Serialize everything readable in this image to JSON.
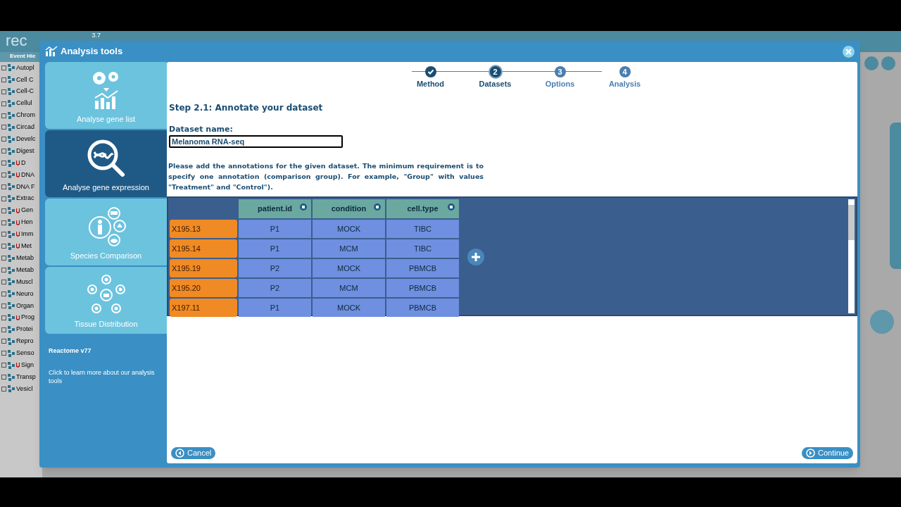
{
  "background_app": {
    "logo": "rec",
    "version_badge": "3.7",
    "tree_header": "Event Hie",
    "tree_items": [
      {
        "label": "Autopl",
        "flag": false
      },
      {
        "label": "Cell C",
        "flag": false
      },
      {
        "label": "Cell-C",
        "flag": false
      },
      {
        "label": "Cellul",
        "flag": false
      },
      {
        "label": "Chrom",
        "flag": false
      },
      {
        "label": "Circad",
        "flag": false
      },
      {
        "label": "Develc",
        "flag": false
      },
      {
        "label": "Digest",
        "flag": false
      },
      {
        "label": "D",
        "flag": true
      },
      {
        "label": "DNA",
        "flag": true
      },
      {
        "label": "DNA F",
        "flag": false
      },
      {
        "label": "Extrac",
        "flag": false
      },
      {
        "label": "Gen",
        "flag": true
      },
      {
        "label": "Hen",
        "flag": true
      },
      {
        "label": "Imm",
        "flag": true
      },
      {
        "label": "Met",
        "flag": true
      },
      {
        "label": "Metab",
        "flag": false
      },
      {
        "label": "Metab",
        "flag": false
      },
      {
        "label": "Muscl",
        "flag": false
      },
      {
        "label": "Neuro",
        "flag": false
      },
      {
        "label": "Organ",
        "flag": false
      },
      {
        "label": "Prog",
        "flag": true
      },
      {
        "label": "Protei",
        "flag": false
      },
      {
        "label": "Repro",
        "flag": false
      },
      {
        "label": "Senso",
        "flag": false
      },
      {
        "label": "Sign",
        "flag": true
      },
      {
        "label": "Transp",
        "flag": false
      },
      {
        "label": "Vesicl",
        "flag": false
      }
    ]
  },
  "dialog": {
    "title": "Analysis tools",
    "sidebar": {
      "items": [
        {
          "label": "Analyse gene list",
          "kind": "genelist",
          "selected": false
        },
        {
          "label": "Analyse gene expression",
          "kind": "expression",
          "selected": true
        },
        {
          "label": "Species Comparison",
          "kind": "species",
          "selected": false
        },
        {
          "label": "Tissue Distribution",
          "kind": "tissue",
          "selected": false
        }
      ],
      "version": "Reactome v77",
      "info": "Click to learn more about our analysis tools"
    },
    "steps": [
      {
        "label": "Method",
        "completed": true,
        "selected": false
      },
      {
        "number": "2",
        "label": "Datasets",
        "completed": false,
        "selected": true
      },
      {
        "number": "3",
        "label": "Options",
        "completed": false,
        "selected": false
      },
      {
        "number": "4",
        "label": "Analysis",
        "completed": false,
        "selected": false
      }
    ],
    "heading": "Step 2.1: Annotate your dataset",
    "dataset_name": {
      "label": "Dataset name:",
      "value": "Melanoma RNA-seq"
    },
    "description": "Please add the annotations for the given dataset. The minimum requirement is to specify one annotation (comparison group). For example, \"Group\" with values \"Treatment\" and \"Control\").",
    "table": {
      "columns": [
        "patient.id",
        "condition",
        "cell.type"
      ],
      "rows": [
        {
          "sample": "X195.13",
          "cells": [
            "P1",
            "MOCK",
            "TIBC"
          ]
        },
        {
          "sample": "X195.14",
          "cells": [
            "P1",
            "MCM",
            "TIBC"
          ]
        },
        {
          "sample": "X195.19",
          "cells": [
            "P2",
            "MOCK",
            "PBMCB"
          ]
        },
        {
          "sample": "X195.20",
          "cells": [
            "P2",
            "MCM",
            "PBMCB"
          ]
        },
        {
          "sample": "X197.11",
          "cells": [
            "P1",
            "MOCK",
            "PBMCB"
          ]
        }
      ]
    },
    "buttons": {
      "cancel": "Cancel",
      "continue": "Continue"
    }
  }
}
